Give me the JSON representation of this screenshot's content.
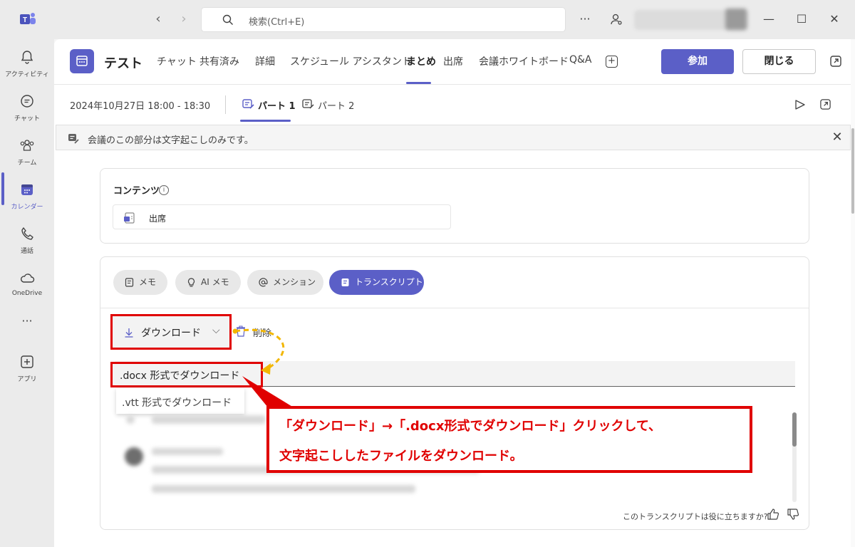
{
  "titlebar": {
    "search_placeholder": "検索(Ctrl+E)",
    "more": "···",
    "window_controls": [
      "—",
      "☐",
      "✕"
    ]
  },
  "rail": {
    "items": [
      {
        "label": "アクティビティ",
        "icon": "bell-icon"
      },
      {
        "label": "チャット",
        "icon": "chat-icon"
      },
      {
        "label": "チーム",
        "icon": "teams-icon"
      },
      {
        "label": "カレンダー",
        "icon": "calendar-icon"
      },
      {
        "label": "通話",
        "icon": "phone-icon"
      },
      {
        "label": "OneDrive",
        "icon": "cloud-icon"
      },
      {
        "label": "···",
        "icon": "more-icon"
      },
      {
        "label": "アプリ",
        "icon": "add-app-icon"
      }
    ]
  },
  "header": {
    "title": "テスト",
    "tabs": [
      "チャット",
      "共有済み",
      "詳細",
      "スケジュール アシスタント",
      "まとめ",
      "出席",
      "会議ホワイトボード",
      "Q&A"
    ],
    "plus": "+",
    "join_label": "参加",
    "close_label": "閉じる"
  },
  "subheader": {
    "date": "2024年10月27日 18:00 - 18:30",
    "parts": [
      "パート 1",
      "パート 2"
    ]
  },
  "banner": {
    "text": "会議のこの部分は文字起こしのみです。",
    "close": "✕"
  },
  "contents": {
    "heading": "コンテンツ",
    "info": "i",
    "item": "出席"
  },
  "transcript": {
    "pills": [
      "メモ",
      "AI メモ",
      "メンション",
      "トランスクリプト"
    ],
    "download_label": "ダウンロード",
    "chevron": "⌵",
    "delete_label": "削除",
    "menu": {
      "docx": ".docx 形式でダウンロード",
      "vtt": ".vtt 形式でダウンロード"
    },
    "helpful": "このトランスクリプトは役に立ちますか?"
  },
  "callout": {
    "line1": "「ダウンロード」→「.docx形式でダウンロード」クリックして、",
    "line2": "文字起こししたファイルをダウンロード。"
  },
  "colors": {
    "accent": "#5b5fc7",
    "annotation_red": "#e00000",
    "annotation_arrow": "#f2b600"
  }
}
